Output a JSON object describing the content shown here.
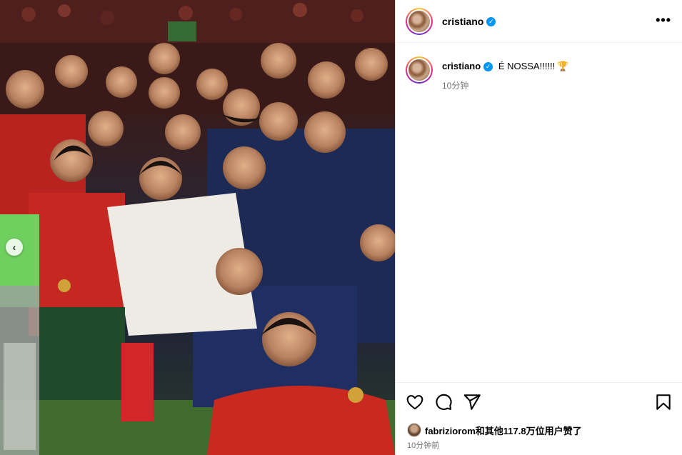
{
  "post": {
    "username": "cristiano",
    "verified_mark": "✓",
    "more_label": "•••",
    "caption": {
      "username": "cristiano",
      "text": "É NOSSA!!!!!!",
      "emoji": "🏆",
      "time": "10分钟"
    },
    "likes": {
      "text": "fabriziorom和其他117.8万位用户赞了"
    },
    "time": "10分钟前",
    "carousel_prev": "‹"
  },
  "icons": {
    "like": "heart-icon",
    "comment": "comment-icon",
    "share": "paper-plane-icon",
    "save": "bookmark-icon",
    "more": "more-horizontal-icon",
    "trophy": "trophy-icon"
  },
  "colors": {
    "verified": "#0095f6",
    "secondary_text": "#737373",
    "divider": "#efefef"
  }
}
